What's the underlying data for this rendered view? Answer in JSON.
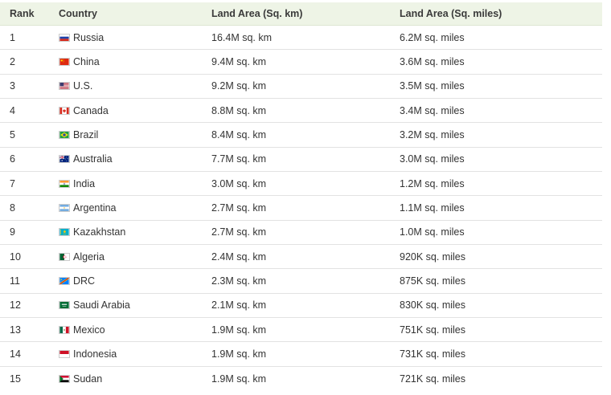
{
  "headers": {
    "rank": "Rank",
    "country": "Country",
    "km": "Land Area (Sq. km)",
    "miles": "Land Area (Sq. miles)"
  },
  "rows": [
    {
      "rank": "1",
      "country": "Russia",
      "km": "16.4M sq. km",
      "miles": "6.2M sq. miles",
      "flag": "flag-russia"
    },
    {
      "rank": "2",
      "country": "China",
      "km": "9.4M sq. km",
      "miles": "3.6M sq. miles",
      "flag": "flag-china"
    },
    {
      "rank": "3",
      "country": "U.S.",
      "km": "9.2M sq. km",
      "miles": "3.5M sq. miles",
      "flag": "flag-us"
    },
    {
      "rank": "4",
      "country": "Canada",
      "km": "8.8M sq. km",
      "miles": "3.4M sq. miles",
      "flag": "flag-canada"
    },
    {
      "rank": "5",
      "country": "Brazil",
      "km": "8.4M sq. km",
      "miles": "3.2M sq. miles",
      "flag": "flag-brazil"
    },
    {
      "rank": "6",
      "country": "Australia",
      "km": "7.7M sq. km",
      "miles": "3.0M sq. miles",
      "flag": "flag-australia"
    },
    {
      "rank": "7",
      "country": "India",
      "km": "3.0M sq. km",
      "miles": "1.2M sq. miles",
      "flag": "flag-india"
    },
    {
      "rank": "8",
      "country": "Argentina",
      "km": "2.7M sq. km",
      "miles": "1.1M sq. miles",
      "flag": "flag-argentina"
    },
    {
      "rank": "9",
      "country": "Kazakhstan",
      "km": "2.7M sq. km",
      "miles": "1.0M sq. miles",
      "flag": "flag-kazakhstan"
    },
    {
      "rank": "10",
      "country": "Algeria",
      "km": "2.4M sq. km",
      "miles": "920K sq. miles",
      "flag": "flag-algeria"
    },
    {
      "rank": "11",
      "country": "DRC",
      "km": "2.3M sq. km",
      "miles": "875K sq. miles",
      "flag": "flag-drc"
    },
    {
      "rank": "12",
      "country": "Saudi Arabia",
      "km": "2.1M sq. km",
      "miles": "830K sq. miles",
      "flag": "flag-saudi-arabia"
    },
    {
      "rank": "13",
      "country": "Mexico",
      "km": "1.9M sq. km",
      "miles": "751K sq. miles",
      "flag": "flag-mexico"
    },
    {
      "rank": "14",
      "country": "Indonesia",
      "km": "1.9M sq. km",
      "miles": "731K sq. miles",
      "flag": "flag-indonesia"
    },
    {
      "rank": "15",
      "country": "Sudan",
      "km": "1.9M sq. km",
      "miles": "721K sq. miles",
      "flag": "flag-sudan"
    }
  ]
}
